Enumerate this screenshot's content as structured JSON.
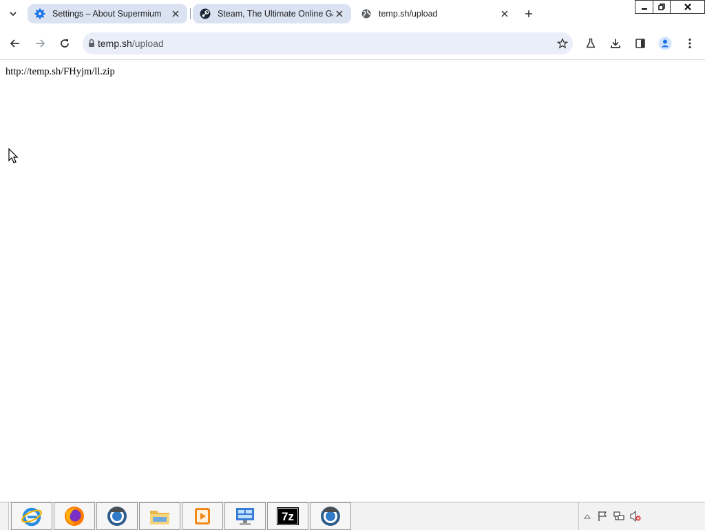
{
  "tabs": [
    {
      "title": "Settings – About Supermium",
      "icon": "gear-icon",
      "active": false
    },
    {
      "title": "Steam, The Ultimate Online Game Platform",
      "icon": "steam-icon",
      "active": false
    },
    {
      "title": "temp.sh/upload",
      "icon": "globe-icon",
      "active": true
    }
  ],
  "omnibox": {
    "domain": "temp.sh",
    "path": "/upload"
  },
  "content": {
    "text": "http://temp.sh/FHyjm/ll.zip"
  },
  "taskbar": {
    "apps": [
      "internet-explorer-icon",
      "firefox-icon",
      "chromium-icon",
      "file-explorer-icon",
      "media-player-icon",
      "control-panel-icon",
      "7zip-icon",
      "chromium-icon"
    ],
    "sevenzip_label": "7z"
  },
  "colors": {
    "accent": "#1a73e8",
    "tab_inactive": "#dbe3f3",
    "omnibox_bg": "#e9eef8"
  }
}
